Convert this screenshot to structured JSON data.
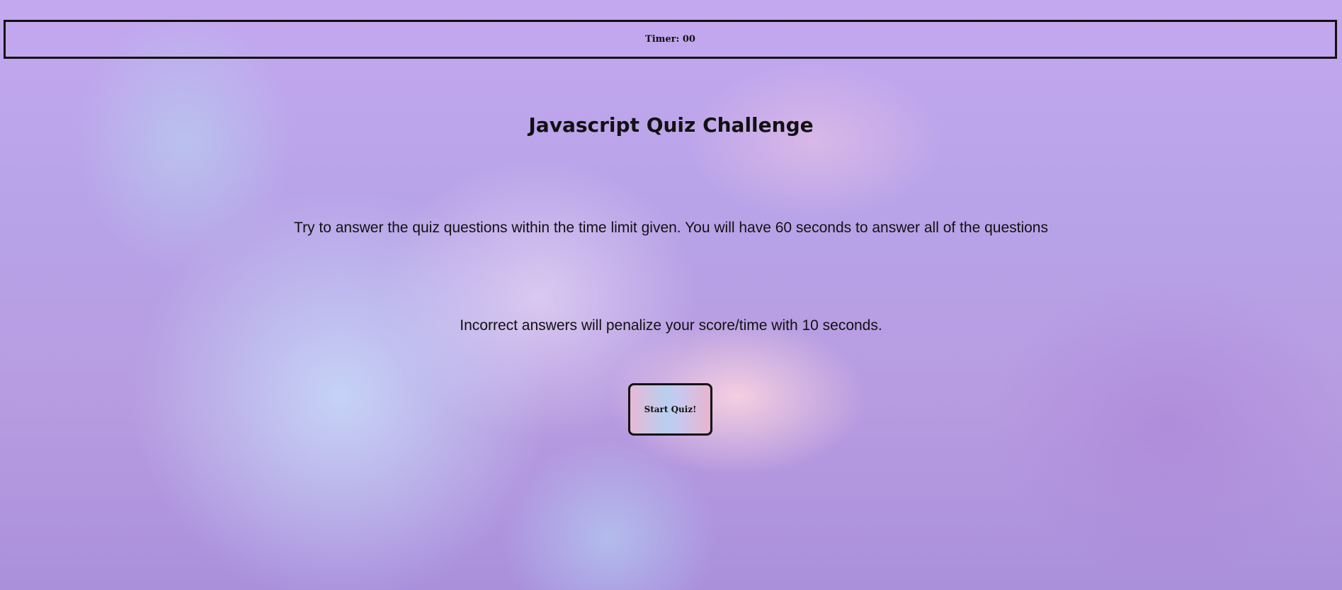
{
  "header": {
    "timer_label": "Timer: 00"
  },
  "main": {
    "title": "Javascript Quiz Challenge",
    "instruction_time": "Try to answer the quiz questions within the time limit given. You will have 60 seconds to answer all of the questions",
    "instruction_penalty": "Incorrect answers will penalize your score/time with 10 seconds.",
    "start_button_label": "Start Quiz!"
  }
}
